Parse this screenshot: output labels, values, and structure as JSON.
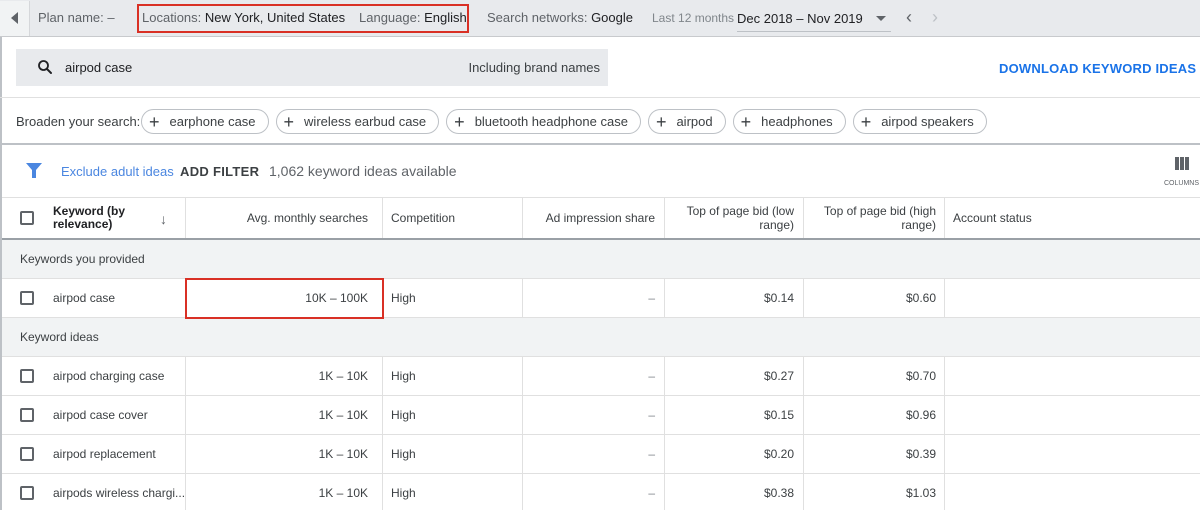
{
  "topbar": {
    "plan_label": "Plan name:",
    "plan_value": "–",
    "locations_label": "Locations:",
    "locations_value": "New York, United States",
    "language_label": "Language:",
    "language_value": "English",
    "networks_label": "Search networks:",
    "networks_value": "Google",
    "period_label": "Last 12 months",
    "date_range": "Dec 2018 – Nov 2019"
  },
  "search": {
    "query": "airpod case",
    "brand_option": "Including brand names",
    "download_label": "DOWNLOAD KEYWORD IDEAS"
  },
  "broaden": {
    "label": "Broaden your search:",
    "chips": [
      "earphone case",
      "wireless earbud case",
      "bluetooth headphone case",
      "airpod",
      "headphones",
      "airpod speakers"
    ]
  },
  "filters": {
    "exclude_label": "Exclude adult ideas",
    "add_filter_label": "ADD FILTER",
    "count_text": "1,062 keyword ideas available",
    "columns_label": "COLUMNS"
  },
  "table": {
    "headers": {
      "keyword": "Keyword (by relevance)",
      "avg": "Avg. monthly searches",
      "competition": "Competition",
      "impression": "Ad impression share",
      "bid_low": "Top of page bid (low range)",
      "bid_high": "Top of page bid (high range)",
      "status": "Account status"
    },
    "group_provided": "Keywords you provided",
    "provided": [
      {
        "keyword": "airpod case",
        "avg": "10K – 100K",
        "competition": "High",
        "impression": "–",
        "bid_low": "$0.14",
        "bid_high": "$0.60",
        "status": ""
      }
    ],
    "group_ideas": "Keyword ideas",
    "ideas": [
      {
        "keyword": "airpod charging case",
        "avg": "1K – 10K",
        "competition": "High",
        "impression": "–",
        "bid_low": "$0.27",
        "bid_high": "$0.70",
        "status": ""
      },
      {
        "keyword": "airpod case cover",
        "avg": "1K – 10K",
        "competition": "High",
        "impression": "–",
        "bid_low": "$0.15",
        "bid_high": "$0.96",
        "status": ""
      },
      {
        "keyword": "airpod replacement",
        "avg": "1K – 10K",
        "competition": "High",
        "impression": "–",
        "bid_low": "$0.20",
        "bid_high": "$0.39",
        "status": ""
      },
      {
        "keyword": "airpods wireless chargi...",
        "avg": "1K – 10K",
        "competition": "High",
        "impression": "–",
        "bid_low": "$0.38",
        "bid_high": "$1.03",
        "status": ""
      }
    ]
  },
  "colors": {
    "accent": "#1a73e8",
    "highlight": "#d93025"
  }
}
